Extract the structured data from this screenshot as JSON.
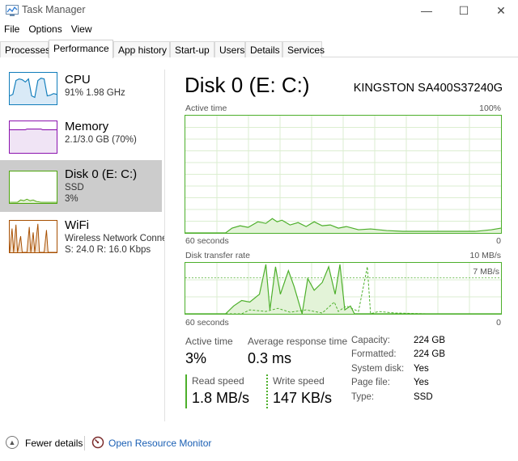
{
  "window": {
    "title": "Task Manager",
    "min": "—",
    "max": "☐",
    "close": "✕"
  },
  "menu": [
    "File",
    "Options",
    "View"
  ],
  "tabs": [
    "Processes",
    "Performance",
    "App history",
    "Start-up",
    "Users",
    "Details",
    "Services"
  ],
  "active_tab": "Performance",
  "sidebar": {
    "items": [
      {
        "name": "CPU",
        "line1": "91%  1.98 GHz",
        "line2": "",
        "color": "#117dbb"
      },
      {
        "name": "Memory",
        "line1": "2.1/3.0 GB (70%)",
        "line2": "",
        "color": "#8b12ae"
      },
      {
        "name": "Disk 0 (E: C:)",
        "line1": "SSD",
        "line2": "3%",
        "color": "#4da60c",
        "selected": true
      },
      {
        "name": "WiFi",
        "line1": "Wireless Network Conne",
        "line2": "S: 24.0  R: 16.0 Kbps",
        "color": "#a74f01"
      }
    ]
  },
  "disk": {
    "title": "Disk 0 (E: C:)",
    "model": "KINGSTON SA400S37240G",
    "graph1": {
      "label": "Active time",
      "max": "100%",
      "xlabel": "60 seconds",
      "xmin": "0"
    },
    "graph2": {
      "label": "Disk transfer rate",
      "max": "10 MB/s",
      "marker": "7 MB/s",
      "xlabel": "60 seconds",
      "xmin": "0"
    },
    "active_time_label": "Active time",
    "active_time_value": "3%",
    "avg_response_label": "Average response time",
    "avg_response_value": "0.3 ms",
    "read_label": "Read speed",
    "read_value": "1.8 MB/s",
    "write_label": "Write speed",
    "write_value": "147 KB/s",
    "info": [
      {
        "key": "Capacity:",
        "value": "224 GB"
      },
      {
        "key": "Formatted:",
        "value": "224 GB"
      },
      {
        "key": "System disk:",
        "value": "Yes"
      },
      {
        "key": "Page file:",
        "value": "Yes"
      },
      {
        "key": "Type:",
        "value": "SSD"
      }
    ]
  },
  "footer": {
    "fewer_details": "Fewer details",
    "resource_monitor": "Open Resource Monitor"
  },
  "colors": {
    "disk_green": "#4caf2a",
    "grid": "#dbeed0",
    "link": "#1a5fb4"
  }
}
